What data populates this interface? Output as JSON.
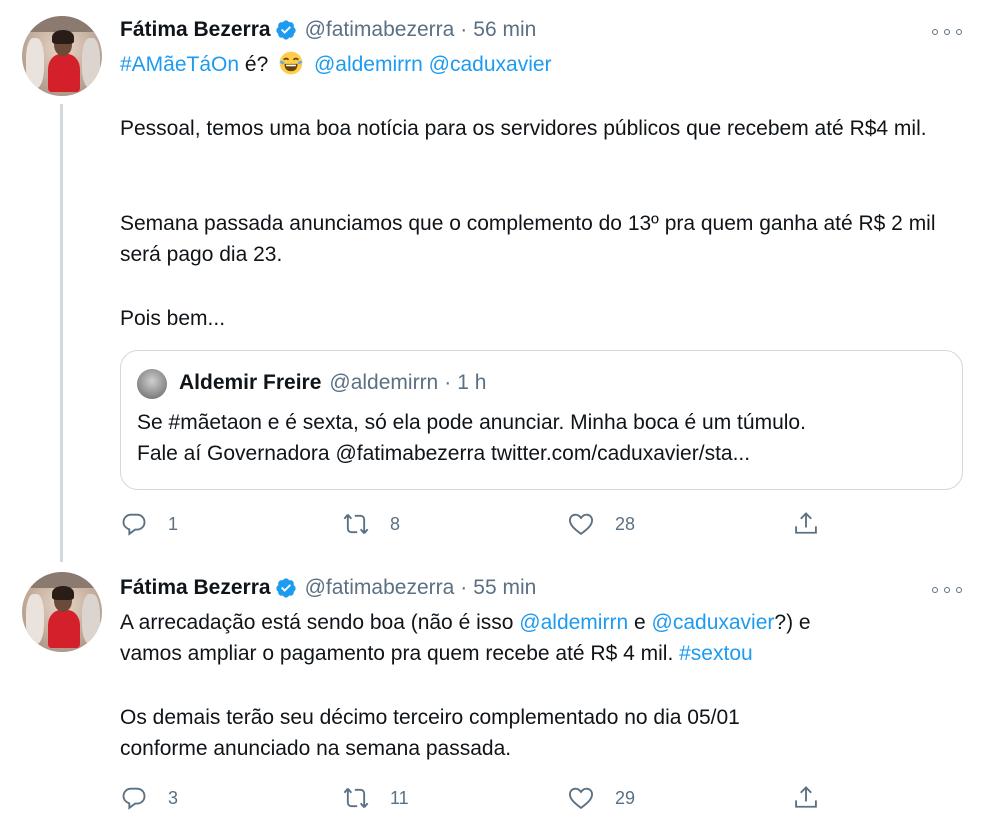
{
  "tweets": [
    {
      "author_name": "Fátima Bezerra",
      "handle": "@fatimabezerra",
      "separator": "·",
      "time": "56 min",
      "line1": {
        "hashtag": "#AMãeTáOn",
        "mid": "é?",
        "mention1": "@aldemirrn",
        "mention2": "@caduxavier"
      },
      "para1": "Pessoal, temos uma boa notícia para os servidores públicos que recebem até R$4 mil.",
      "para2": "Semana passada anunciamos que o complemento do 13º pra quem ganha até R$ 2 mil será pago dia 23.",
      "para3": "Pois bem...",
      "quote": {
        "author_name": "Aldemir Freire",
        "handle": "@aldemirrn",
        "separator": "·",
        "time": "1 h",
        "text_line1": "Se #mãetaon e é sexta, só ela pode anunciar. Minha boca é um túmulo.",
        "text_line2": "Fale aí Governadora @fatimabezerra twitter.com/caduxavier/sta..."
      },
      "stats": {
        "replies": "1",
        "retweets": "8",
        "likes": "28"
      }
    },
    {
      "author_name": "Fátima Bezerra",
      "handle": "@fatimabezerra",
      "separator": "·",
      "time": "55 min",
      "line1_pre": "A arrecadação está sendo boa (não é isso",
      "mention1": "@aldemirrn",
      "line1_mid": "e",
      "mention2": "@caduxavier",
      "line1_post": "?)  e",
      "line2_pre": "vamos ampliar o pagamento pra quem recebe até R$ 4 mil.",
      "hashtag": "#sextou",
      "para2_line1": "Os demais terão seu décimo terceiro complementado no dia 05/01",
      "para2_line2": "conforme anunciado na semana passada.",
      "stats": {
        "replies": "3",
        "retweets": "11",
        "likes": "29"
      }
    }
  ],
  "icons": {
    "verified": "verified-badge-icon",
    "more": "more-options-icon",
    "reply": "reply-icon",
    "retweet": "retweet-icon",
    "like": "like-icon",
    "share": "share-icon",
    "emoji": "laughing-crying-emoji"
  },
  "colors": {
    "link": "#1d9bf0",
    "muted": "#5b7083",
    "text": "#0f1419",
    "border": "#cfd9de"
  }
}
